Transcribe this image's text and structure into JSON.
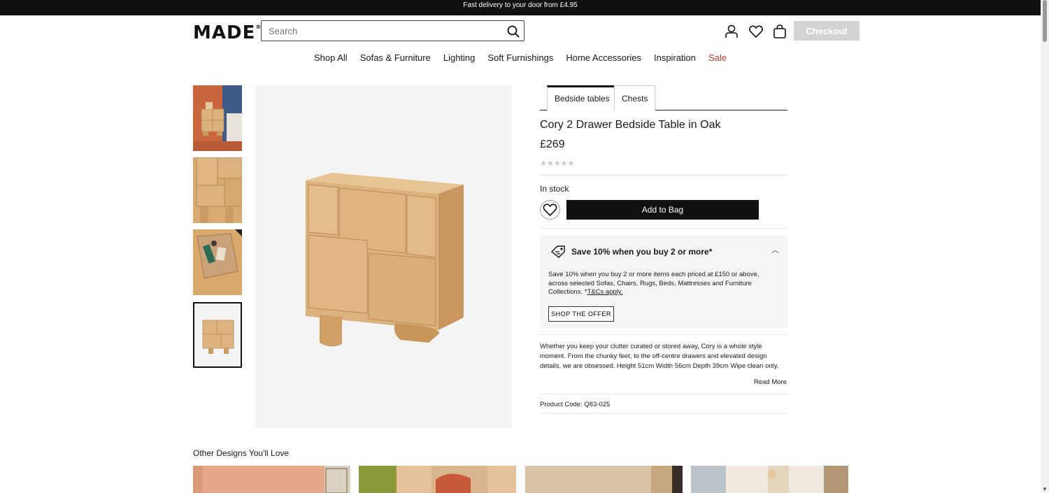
{
  "promo": {
    "text": "Fast delivery to your door from £4.95"
  },
  "header": {
    "logo": "MADE",
    "logo_mark": "®",
    "search_placeholder": "Search",
    "checkout_label": "Checkout",
    "icons": [
      "user-icon",
      "heart-icon",
      "bag-icon",
      "search-icon"
    ]
  },
  "nav": {
    "items": [
      "Shop All",
      "Sofas & Furniture",
      "Lighting",
      "Soft Furnishings",
      "Home Accessories",
      "Inspiration",
      "Sale"
    ],
    "sale_color": "#c0392b"
  },
  "product": {
    "tabs": [
      "Bedside tables",
      "Chests"
    ],
    "title": "Cory 2 Drawer Bedside Table in Oak",
    "price": "£269",
    "rating": {
      "stars": 5,
      "filled": 0
    },
    "stock": "In stock",
    "add_to_bag": "Add to Bag",
    "offer": {
      "title": "Save 10% when you buy 2 or more*",
      "text": "Save 10% when you buy 2 or more items each priced at £150 or above, across selected Sofas, Chairs, Rugs, Beds, Mattresses and Furniture Collections. *",
      "link": "T&Cs apply.",
      "button": "SHOP THE OFFER"
    },
    "description": "Whether you keep your clutter curated or stored away, Cory is a whole style moment. From the chunky feet, to the off-centre drawers and elevated design details, we are obsessed. Height 51cm Width 56cm Depth 39cm Wipe clean only.",
    "read_more": "Read More",
    "code_label": "Product Code:",
    "code_value": "Q83-025"
  },
  "recommendations": {
    "title": "Other Designs You'll Love"
  },
  "colors": {
    "oak": "#dcb27e",
    "terracotta": "#c8643c",
    "dark": "#111111"
  }
}
